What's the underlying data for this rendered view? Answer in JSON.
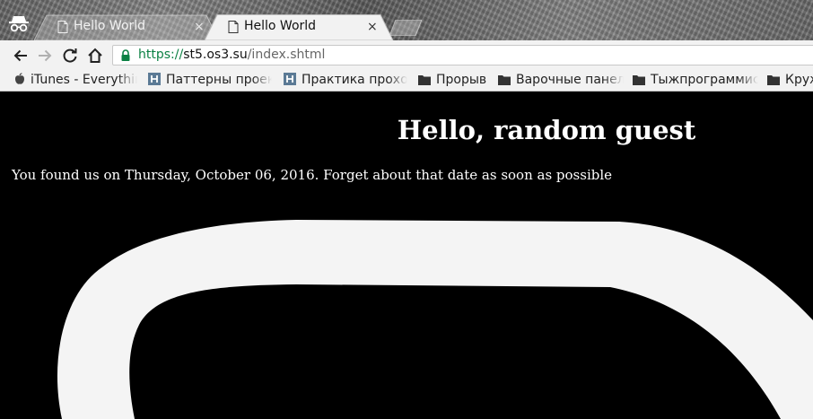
{
  "browser": {
    "tabs": [
      {
        "title": "Hello World",
        "active": false,
        "close": "×"
      },
      {
        "title": "Hello World",
        "active": true,
        "close": "×"
      }
    ],
    "address_bar": {
      "scheme": "https://",
      "host": "st5.os3.su",
      "path": "/index.shtml",
      "secure": true
    },
    "bookmarks": [
      {
        "label": "iTunes - Everythin",
        "icon": "apple-icon"
      },
      {
        "label": "Паттерны проек",
        "icon": "habr-icon"
      },
      {
        "label": "Практика прохо",
        "icon": "habr-icon"
      },
      {
        "label": "Прорыв",
        "icon": "folder-icon"
      },
      {
        "label": "Варочные панел",
        "icon": "folder-icon"
      },
      {
        "label": "Тыжпрограммис",
        "icon": "folder-icon"
      },
      {
        "label": "Круж",
        "icon": "folder-icon"
      }
    ]
  },
  "page": {
    "heading": "Hello, random guest",
    "visit_message": "You found us on Thursday, October 06, 2016. Forget about that date as soon as possible"
  },
  "colors": {
    "page_background": "#000000",
    "page_text": "#ffffff",
    "shape_fill": "#f4f4f4",
    "secure_scheme": "#0b8043"
  }
}
